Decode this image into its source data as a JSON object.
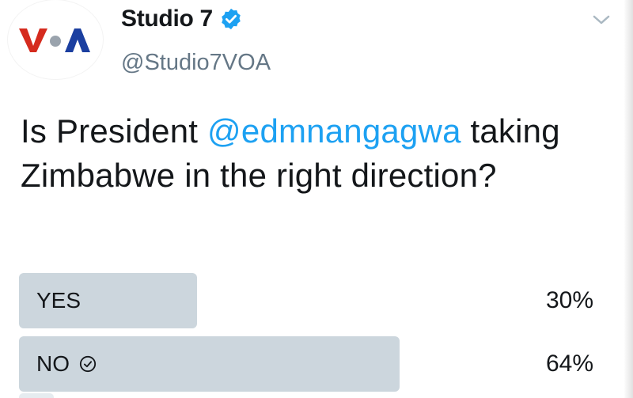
{
  "tweet": {
    "display_name": "Studio 7",
    "handle": "@Studio7VOA",
    "verified": true,
    "avatar_icon": "voa-logo-icon",
    "text_before": "Is President ",
    "mention": "@edmnangagwa",
    "text_after": " taking Zimbabwe in the right direction?"
  },
  "poll": {
    "options": [
      {
        "label": "YES",
        "percent_text": "30%",
        "percent": 30,
        "selected": false
      },
      {
        "label": "NO",
        "percent_text": "64%",
        "percent": 64,
        "selected": true
      }
    ]
  },
  "colors": {
    "mention": "#1da1f2",
    "verified_badge": "#1da1f2",
    "poll_bar": "#ccd6dd",
    "voa_red": "#d52b1e",
    "voa_blue": "#1b3fa0"
  }
}
